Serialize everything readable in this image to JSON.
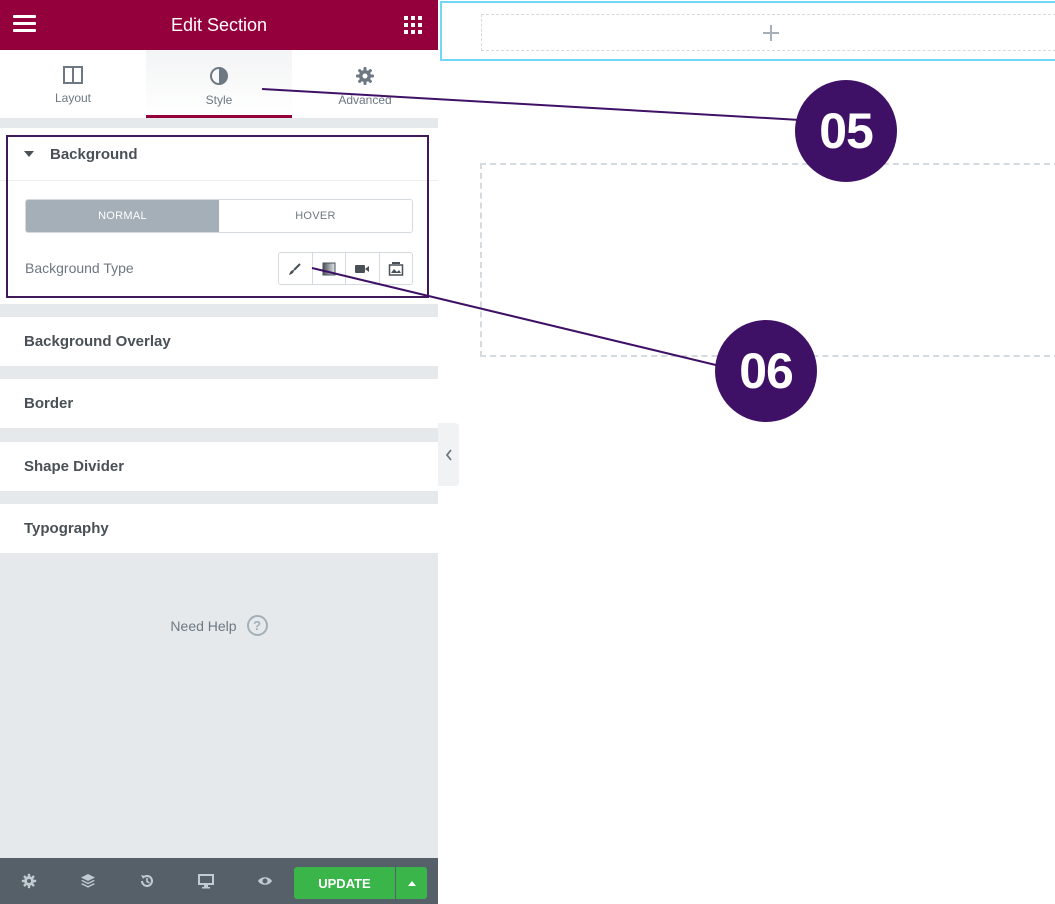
{
  "colors": {
    "brand": "#93003c",
    "callout": "#3f1166",
    "update": "#39b54a"
  },
  "header": {
    "title": "Edit Section",
    "menu_icon": "hamburger-icon",
    "apps_icon": "grid-icon"
  },
  "tabs": [
    {
      "label": "Layout",
      "icon": "columns-icon",
      "active": false
    },
    {
      "label": "Style",
      "icon": "half-circle-icon",
      "active": true
    },
    {
      "label": "Advanced",
      "icon": "gear-icon",
      "active": false
    }
  ],
  "background": {
    "title": "Background",
    "states": {
      "normal": "NORMAL",
      "hover": "HOVER",
      "selected": "NORMAL"
    },
    "type_label": "Background Type",
    "type_options": [
      "brush-icon",
      "gradient-icon",
      "video-icon",
      "slideshow-icon"
    ]
  },
  "sections": [
    "Background Overlay",
    "Border",
    "Shape Divider",
    "Typography"
  ],
  "help": {
    "label": "Need Help",
    "icon": "question-icon"
  },
  "footer": {
    "icons": [
      "settings-icon",
      "layers-icon",
      "history-icon",
      "responsive-icon",
      "preview-icon"
    ],
    "update_label": "UPDATE"
  },
  "annotations": {
    "callout_1": "05",
    "callout_2": "06"
  }
}
